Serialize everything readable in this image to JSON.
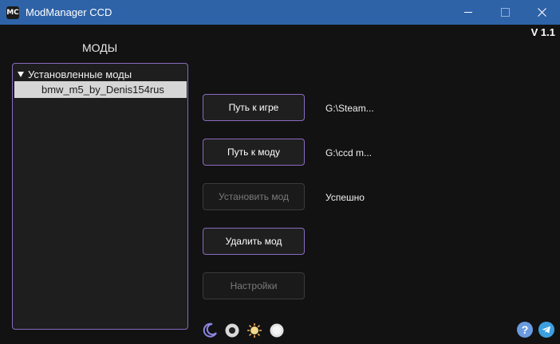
{
  "window": {
    "title": "ModManager CCD",
    "app_icon_text": "MC"
  },
  "version": "V 1.1",
  "mods": {
    "title": "МОДЫ",
    "tree_header": "Установленные моды",
    "items": [
      "bmw_m5_by_Denis154rus"
    ]
  },
  "buttons": {
    "game_path": "Путь к игре",
    "mod_path": "Путь к моду",
    "install": "Установить мод",
    "delete": "Удалить мод",
    "settings": "Настройки"
  },
  "status": {
    "game_path": "G:\\Steam...",
    "mod_path": "G:\\ccd m...",
    "install": "Успешно"
  },
  "footer": {
    "help": "?",
    "theme_icons": [
      "moon-icon",
      "dark-theme-icon",
      "sun-icon",
      "light-theme-icon"
    ],
    "link_icons": [
      "help-icon",
      "telegram-icon"
    ]
  },
  "colors": {
    "titlebar": "#2f63a8",
    "background": "#121212",
    "accent_border": "#8a6bbf",
    "selected_item": "#d6d6d6"
  }
}
